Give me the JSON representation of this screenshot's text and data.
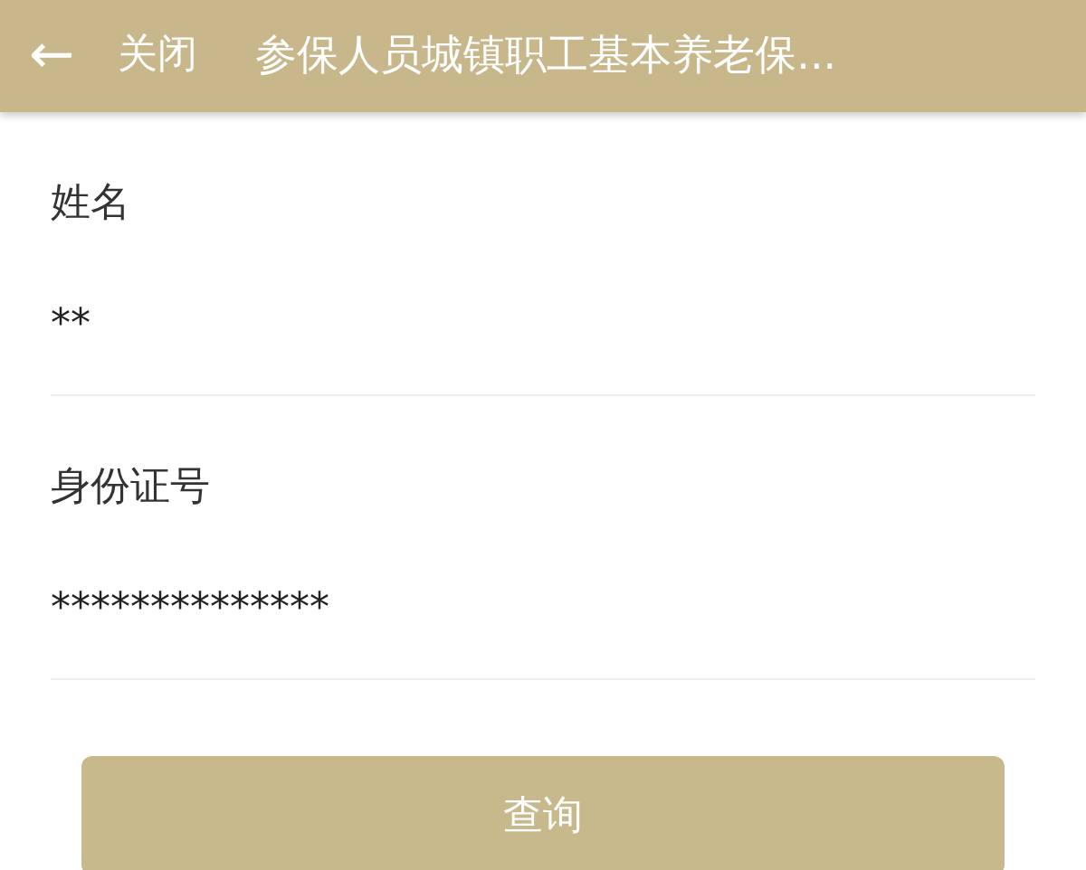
{
  "header": {
    "back": "←",
    "close": "关闭",
    "title": "参保人员城镇职工基本养老保..."
  },
  "fields": [
    {
      "label": "姓名",
      "value": "**"
    },
    {
      "label": "身份证号",
      "value": "**************"
    }
  ],
  "button": "查询"
}
